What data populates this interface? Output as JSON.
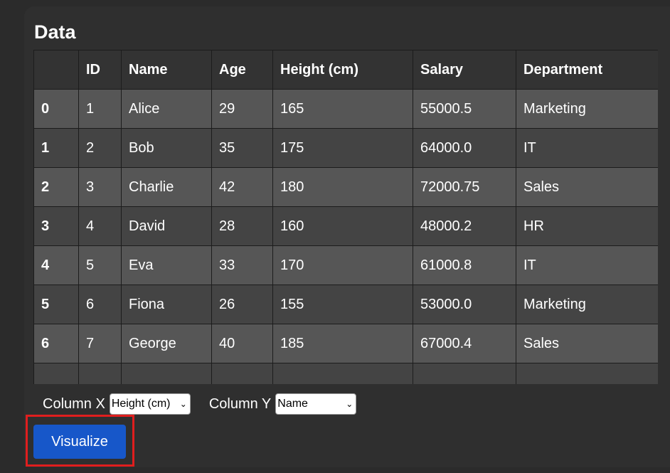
{
  "section": {
    "title": "Data"
  },
  "table": {
    "columns": [
      "",
      "ID",
      "Name",
      "Age",
      "Height (cm)",
      "Salary",
      "Department"
    ],
    "rows": [
      {
        "index": "0",
        "cells": [
          "1",
          "Alice",
          "29",
          "165",
          "55000.5",
          "Marketing"
        ]
      },
      {
        "index": "1",
        "cells": [
          "2",
          "Bob",
          "35",
          "175",
          "64000.0",
          "IT"
        ]
      },
      {
        "index": "2",
        "cells": [
          "3",
          "Charlie",
          "42",
          "180",
          "72000.75",
          "Sales"
        ]
      },
      {
        "index": "3",
        "cells": [
          "4",
          "David",
          "28",
          "160",
          "48000.2",
          "HR"
        ]
      },
      {
        "index": "4",
        "cells": [
          "5",
          "Eva",
          "33",
          "170",
          "61000.8",
          "IT"
        ]
      },
      {
        "index": "5",
        "cells": [
          "6",
          "Fiona",
          "26",
          "155",
          "53000.0",
          "Marketing"
        ]
      },
      {
        "index": "6",
        "cells": [
          "7",
          "George",
          "40",
          "185",
          "67000.4",
          "Sales"
        ]
      },
      {
        "index": "",
        "cells": [
          "",
          "",
          "",
          "",
          "",
          ""
        ]
      }
    ]
  },
  "controls": {
    "x_label": "Column X",
    "x_selected": "Height (cm)",
    "y_label": "Column Y",
    "y_selected": "Name",
    "visualize_label": "Visualize"
  },
  "colors": {
    "accent": "#1757c9",
    "highlight": "#e01e1e"
  }
}
